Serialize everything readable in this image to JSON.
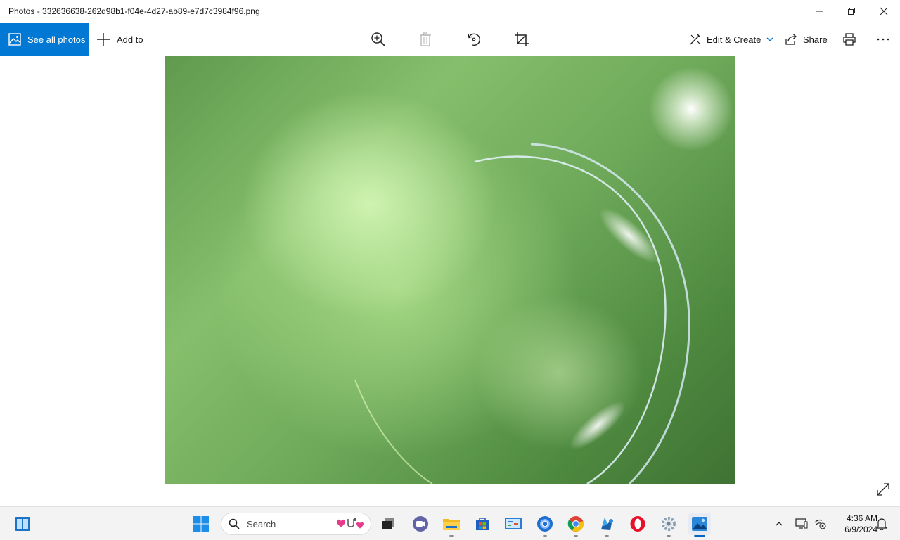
{
  "window": {
    "title": "Photos - 332636638-262d98b1-f04e-4d27-ab89-e7d7c3984f96.png",
    "controls": [
      "minimize-icon",
      "restore-icon",
      "close-icon"
    ]
  },
  "toolbar": {
    "see_all_photos": "See all photos",
    "add_to": "Add to",
    "edit_create": "Edit & Create",
    "share": "Share",
    "icons": [
      "zoom-in-icon",
      "delete-icon",
      "rotate-icon",
      "crop-icon",
      "print-icon",
      "more-icon"
    ]
  },
  "colors": {
    "accent": "#0078d4",
    "taskbar": "#f3f3f3"
  },
  "taskbar": {
    "search_placeholder": "Search",
    "apps": [
      "start-icon",
      "search-icon",
      "task-view-icon",
      "teams-icon",
      "file-explorer-icon",
      "microsoft-store-icon",
      "control-panel-icon",
      "chrome-dev-icon",
      "chrome-icon",
      "app-icon",
      "opera-icon",
      "settings-icon",
      "photos-icon"
    ],
    "time": "4:36 AM",
    "date": "6/9/2024"
  }
}
